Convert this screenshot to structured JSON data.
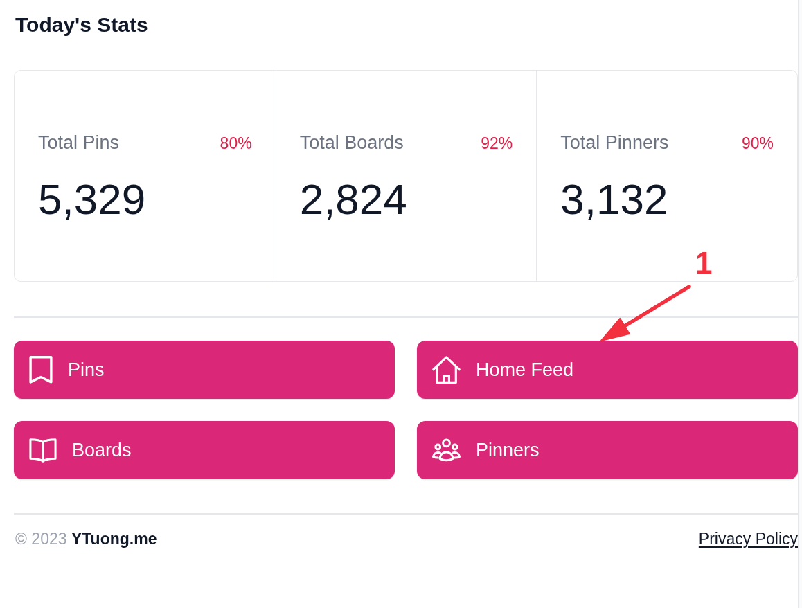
{
  "heading": "Today's Stats",
  "stats": [
    {
      "label": "Total Pins",
      "change": "80%",
      "value": "5,329"
    },
    {
      "label": "Total Boards",
      "change": "92%",
      "value": "2,824"
    },
    {
      "label": "Total Pinners",
      "change": "90%",
      "value": "3,132"
    }
  ],
  "shortcuts": [
    {
      "label": "Pins"
    },
    {
      "label": "Home Feed"
    },
    {
      "label": "Boards"
    },
    {
      "label": "Pinners"
    }
  ],
  "footer": {
    "copyright": "© 2023 **YTuong.me**",
    "privacy_link": "Privacy Policy"
  },
  "annotation": {
    "label": "1"
  }
}
